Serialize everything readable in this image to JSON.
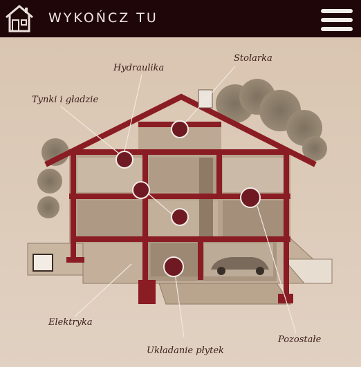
{
  "header": {
    "brand": "WYKOŃCZ TU",
    "logo_icon": "house-logo-icon",
    "menu_icon": "hamburger-menu-icon",
    "background": "#1f0608"
  },
  "hotspots": [
    {
      "id": "hydraulika",
      "label": "Hydraulika"
    },
    {
      "id": "stolarka",
      "label": "Stolarka"
    },
    {
      "id": "tynki",
      "label": "Tynki i gładzie"
    },
    {
      "id": "elektryka",
      "label": "Elektryka"
    },
    {
      "id": "plytki",
      "label": "Układanie płytek"
    },
    {
      "id": "pozostale",
      "label": "Pozostałe"
    }
  ],
  "colors": {
    "accent": "#8a1c24",
    "background": "#dcc9b6"
  }
}
